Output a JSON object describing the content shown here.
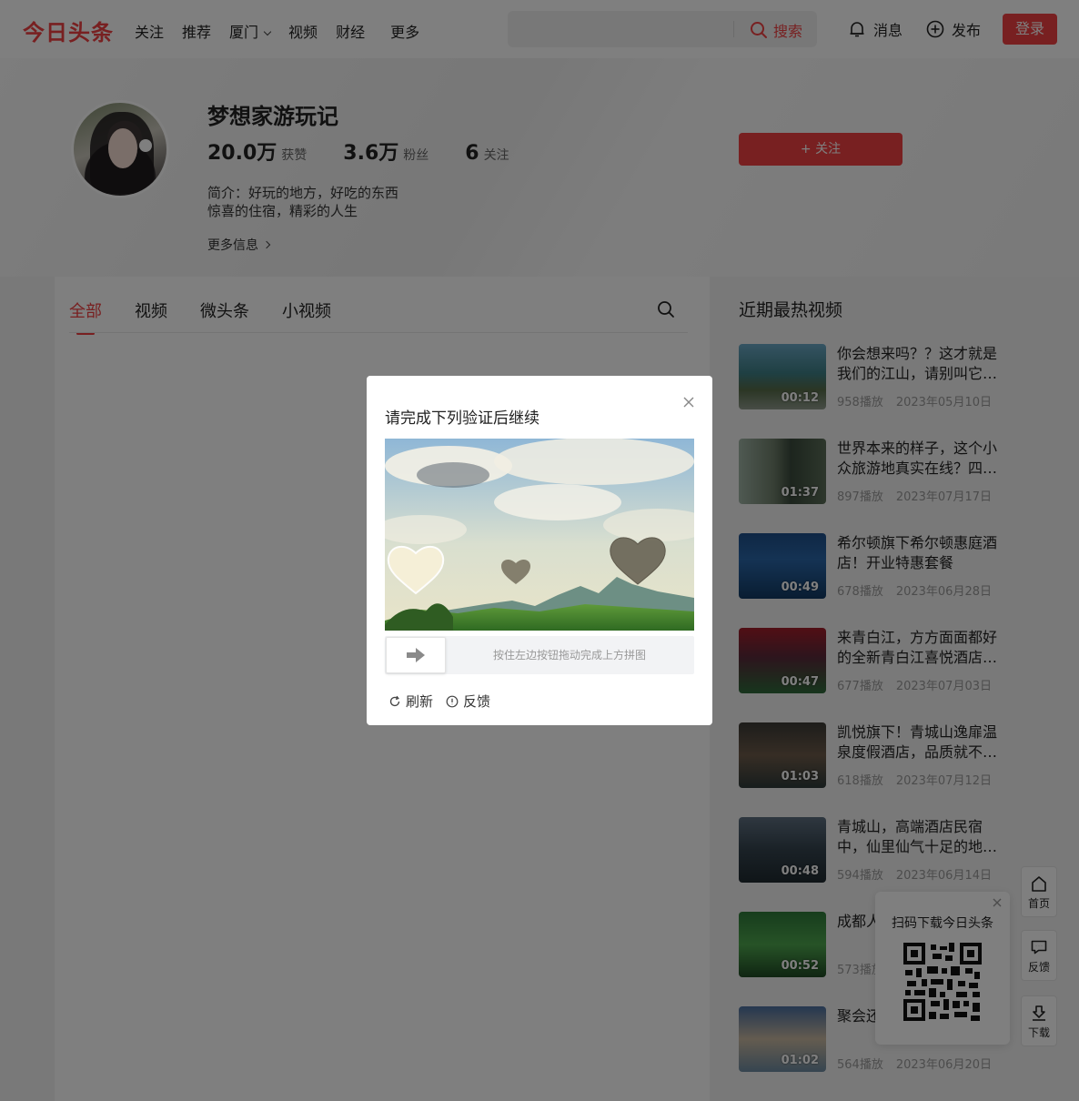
{
  "header": {
    "logo": "今日头条",
    "nav": [
      "关注",
      "推荐",
      "厦门",
      "视频",
      "财经"
    ],
    "nav_more": "更多",
    "search_button": "搜索",
    "search_placeholder": "",
    "messages": "消息",
    "publish": "发布",
    "login": "登录"
  },
  "profile": {
    "name": "梦想家游玩记",
    "likes_num": "20.0万",
    "likes_label": "获赞",
    "fans_num": "3.6万",
    "fans_label": "粉丝",
    "follow_num": "6",
    "follow_label": "关注",
    "bio_line1": "简介：好玩的地方，好吃的东西",
    "bio_line2": "惊喜的住宿，精彩的人生",
    "more_info": "更多信息",
    "follow_button": "+ 关注"
  },
  "tabs": [
    "全部",
    "视频",
    "微头条",
    "小视频"
  ],
  "sidebar": {
    "title": "近期最热视频",
    "videos": [
      {
        "title": "你会想来吗？？这才就是我们的江山，请别叫它…",
        "duration": "00:12",
        "plays": "958播放",
        "date": "2023年05月10日"
      },
      {
        "title": "世界本来的样子，这个小众旅游地真实在线？四…",
        "duration": "01:37",
        "plays": "897播放",
        "date": "2023年07月17日"
      },
      {
        "title": "希尔顿旗下希尔顿惠庭酒店！开业特惠套餐",
        "duration": "00:49",
        "plays": "678播放",
        "date": "2023年06月28日"
      },
      {
        "title": "来青白江，方方面面都好的全新青白江喜悦酒店…",
        "duration": "00:47",
        "plays": "677播放",
        "date": "2023年07月03日"
      },
      {
        "title": "凯悦旗下！青城山逸扉温泉度假酒店，品质就不…",
        "duration": "01:03",
        "plays": "618播放",
        "date": "2023年07月12日"
      },
      {
        "title": "青城山，高端酒店民宿中，仙里仙气十足的地…",
        "duration": "00:48",
        "plays": "594播放",
        "date": "2023年06月14日"
      },
      {
        "title": "成都人了在水",
        "duration": "00:52",
        "plays": "573播放",
        "date": ""
      },
      {
        "title": "聚会还高端年",
        "duration": "01:02",
        "plays": "564播放",
        "date": "2023年06月20日"
      }
    ]
  },
  "toolbar": {
    "home": "首页",
    "feedback": "反馈",
    "download": "下载"
  },
  "qr": {
    "title": "扫码下载今日头条"
  },
  "captcha": {
    "title": "请完成下列验证后继续",
    "slider_tip": "按住左边按钮拖动完成上方拼图",
    "refresh": "刷新",
    "feedback": "反馈"
  },
  "colors": {
    "brand": "#f04142",
    "overlay": "rgba(0,0,0,0.5)"
  }
}
